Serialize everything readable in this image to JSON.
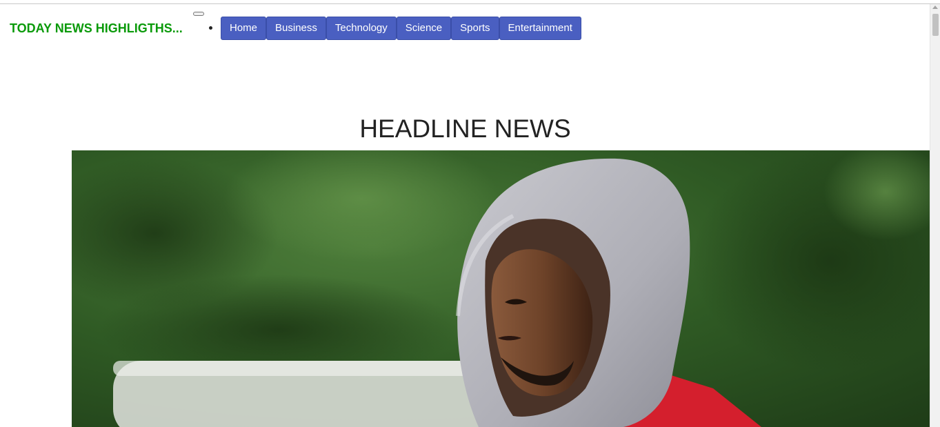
{
  "brand": {
    "title": "TODAY NEWS HIGHLIGTHS..."
  },
  "nav": {
    "items": [
      {
        "label": "Home"
      },
      {
        "label": "Business"
      },
      {
        "label": "Technology"
      },
      {
        "label": "Science"
      },
      {
        "label": "Sports"
      },
      {
        "label": "Entertainment"
      }
    ]
  },
  "main": {
    "headline": "HEADLINE NEWS",
    "hero_image": {
      "subject": "athlete-in-grey-hoodie"
    }
  },
  "colors": {
    "brand": "#0a9a0a",
    "nav_button": "#4a5fc1",
    "nav_text": "#ffffff",
    "headline_text": "#222222"
  }
}
